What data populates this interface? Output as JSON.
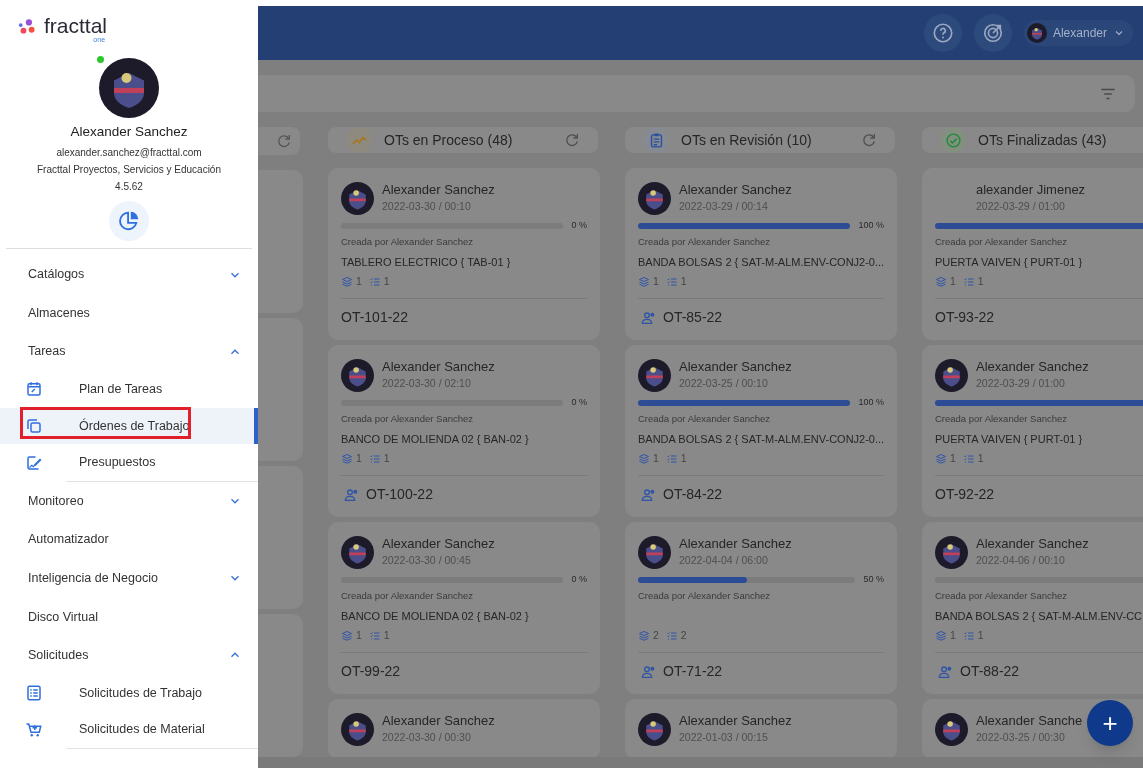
{
  "sidebar": {
    "logo": {
      "word": "fracttal",
      "sub": "one"
    },
    "profile": {
      "online": true,
      "name": "Alexander Sanchez",
      "email": "alexander.sanchez@fracttal.com",
      "company": "Fracttal Proyectos, Servicios y Educación",
      "version": "4.5.62"
    },
    "menu": [
      {
        "label": "Catálogos",
        "expanded": false
      },
      {
        "label": "Almacenes"
      },
      {
        "label": "Tareas",
        "expanded": true,
        "children": [
          {
            "label": "Plan de Tareas",
            "selected": false,
            "highlighted": false
          },
          {
            "label": "Órdenes de Trabajo",
            "selected": true,
            "highlighted": true
          },
          {
            "label": "Presupuestos",
            "selected": false,
            "highlighted": false
          }
        ]
      },
      {
        "label": "Monitoreo",
        "expanded": false
      },
      {
        "label": "Automatizador"
      },
      {
        "label": "Inteligencia de Negocio",
        "expanded": false
      },
      {
        "label": "Disco Virtual"
      },
      {
        "label": "Solicitudes",
        "expanded": true,
        "children": [
          {
            "label": "Solicitudes de Trabajo",
            "selected": false,
            "highlighted": false
          },
          {
            "label": "Solicitudes de Material",
            "selected": false,
            "highlighted": false
          }
        ]
      }
    ]
  },
  "topbar": {
    "user": "Alexander"
  },
  "board": {
    "columns": [
      {
        "kind": "cut",
        "refresh": true
      },
      {
        "kind": "in_progress",
        "title": "OTs en Proceso (48)",
        "refresh": true,
        "cards": [
          {
            "kind": "full",
            "avatar": true,
            "name": "Alexander Sanchez",
            "date": "2022-03-30 / 00:10",
            "level": 0,
            "percent": "0 %",
            "created": "Creada por Alexander Sanchez",
            "equipment": "TABLERO ELECTRICO { TAB-01 }",
            "materials": "1",
            "tasks": "1",
            "assigned": false,
            "code": "OT-101-22"
          },
          {
            "kind": "full",
            "avatar": true,
            "name": "Alexander Sanchez",
            "date": "2022-03-30 / 02:10",
            "level": 0,
            "percent": "0 %",
            "created": "Creada por Alexander Sanchez",
            "equipment": "BANCO DE MOLIENDA 02 { BAN-02 }",
            "materials": "1",
            "tasks": "1",
            "assigned": true,
            "code": "OT-100-22"
          },
          {
            "kind": "full",
            "avatar": true,
            "name": "Alexander Sanchez",
            "date": "2022-03-30 / 00:45",
            "level": 0,
            "percent": "0 %",
            "created": "Creada por Alexander Sanchez",
            "equipment": "BANCO DE MOLIENDA 02 { BAN-02 }",
            "materials": "1",
            "tasks": "1",
            "assigned": false,
            "code": "OT-99-22"
          },
          {
            "kind": "cut",
            "avatar": true,
            "name": "Alexander Sanchez",
            "date": "2022-03-30 / 00:30"
          }
        ]
      },
      {
        "kind": "review",
        "title": "OTs en Revisión (10)",
        "refresh": true,
        "cards": [
          {
            "kind": "full",
            "avatar": true,
            "name": "Alexander Sanchez",
            "date": "2022-03-29 / 00:14",
            "level": 1,
            "percent": "100 %",
            "created": "Creada por Alexander Sanchez",
            "equipment": "BANDA BOLSAS 2 { SAT-M-ALM.ENV-CONJ2-0...",
            "materials": "1",
            "tasks": "1",
            "assigned": true,
            "code": "OT-85-22"
          },
          {
            "kind": "full",
            "avatar": true,
            "name": "Alexander Sanchez",
            "date": "2022-03-25 / 00:10",
            "level": 1,
            "percent": "100 %",
            "created": "Creada por Alexander Sanchez",
            "equipment": "BANDA BOLSAS 2 { SAT-M-ALM.ENV-CONJ2-0...",
            "materials": "1",
            "tasks": "1",
            "assigned": true,
            "code": "OT-84-22"
          },
          {
            "kind": "full",
            "avatar": true,
            "name": "Alexander Sanchez",
            "date": "2022-04-04 / 06:00",
            "level": 0.5,
            "percent": "50 %",
            "created": "Creada por Alexander Sanchez",
            "materials": "2",
            "tasks": "2",
            "assigned": true,
            "code": "OT-71-22"
          },
          {
            "kind": "cut",
            "avatar": true,
            "name": "Alexander Sanchez",
            "date": "2022-01-03 / 00:15"
          }
        ]
      },
      {
        "kind": "finished",
        "title": "OTs Finalizadas (43)",
        "refresh": false,
        "cards": [
          {
            "kind": "full",
            "avatar": false,
            "name": "alexander Jimenez",
            "date": "2022-03-29 / 01:00",
            "level": 1,
            "created": "Creada por Alexander Sanchez",
            "equipment": "PUERTA VAIVEN { PURT-01 }",
            "materials": "1",
            "tasks": "1",
            "assigned": false,
            "code": "OT-93-22"
          },
          {
            "kind": "full",
            "avatar": true,
            "name": "Alexander Sanchez",
            "date": "2022-03-29 / 01:00",
            "level": 1,
            "created": "Creada por Alexander Sanchez",
            "equipment": "PUERTA VAIVEN { PURT-01 }",
            "materials": "1",
            "tasks": "1",
            "assigned": false,
            "code": "OT-92-22"
          },
          {
            "kind": "full",
            "avatar": true,
            "name": "Alexander Sanchez",
            "date": "2022-04-06 / 00:10",
            "level": 0,
            "created": "Creada por Alexander Sanchez",
            "equipment": "BANDA BOLSAS 2 { SAT-M-ALM.ENV-CC",
            "materials": "1",
            "tasks": "1",
            "assigned": true,
            "code": "OT-88-22"
          },
          {
            "kind": "cut",
            "avatar": true,
            "name": "Alexander Sanche",
            "date": "2022-03-25 / 00:30"
          }
        ]
      }
    ]
  },
  "fab": {
    "label": "+"
  }
}
